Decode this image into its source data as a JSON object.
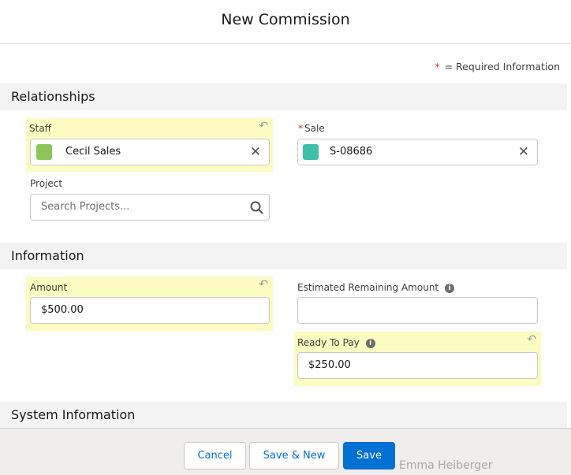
{
  "modal": {
    "title": "New Commission",
    "required_note": "= Required Information",
    "required_marker": "*"
  },
  "sections": {
    "relationships": "Relationships",
    "information": "Information",
    "system": "System Information"
  },
  "staff": {
    "label": "Staff",
    "value": "Cecil Sales",
    "icon_color": "#8dc559"
  },
  "sale": {
    "label": "Sale",
    "value": "S-08686",
    "icon_color": "#3dbfa8"
  },
  "project": {
    "label": "Project",
    "placeholder": "Search Projects..."
  },
  "amount": {
    "label": "Amount",
    "value": "$500.00"
  },
  "estimated": {
    "label": "Estimated Remaining Amount",
    "value": ""
  },
  "ready": {
    "label": "Ready To Pay",
    "value": "$250.00"
  },
  "footer": {
    "cancel": "Cancel",
    "save_new": "Save & New",
    "save": "Save",
    "background_text": "Emma Heiberger"
  },
  "colors": {
    "brand": "#0070d2",
    "highlight": "#fbfbc2"
  }
}
